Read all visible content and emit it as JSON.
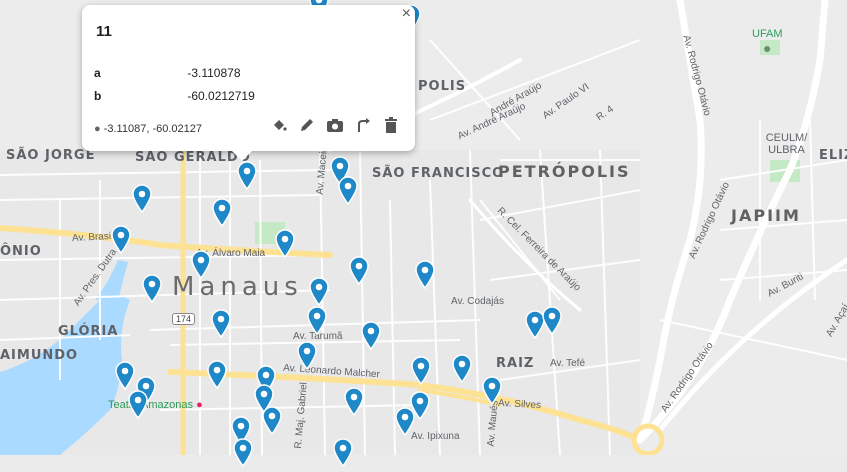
{
  "map": {
    "city_label": "Manaus",
    "neighborhoods": [
      "SÃO JORGE",
      "SÃO GERALDO",
      "SÃO FRANCISCO",
      "PETRÓPOLIS",
      "JAPIIM",
      "RAIZ",
      "GLÓRIA",
      "AIMUNDO",
      "ÔNIO",
      "ELIZ",
      "POLIS"
    ],
    "streets": [
      "Av. Brasil",
      "Av. Álvaro Maia",
      "Av. Pres. Dutra",
      "Av. Tarumã",
      "Av. Leonardo Malcher",
      "Av. Silves",
      "Av. Codajás",
      "Av. Tefé",
      "Av. Ipixuna",
      "Av. Maceió",
      "Av. Rodrigo Otávio",
      "Av. Rodrigo Otávio",
      "Av. Rodrigo Otávio",
      "Av. Buriti",
      "Av. Açaí",
      "Av. André Araújo",
      "Av. Paulo VI",
      "R. 4",
      "R. Cel. Ferreira de Araújo",
      "R. Maj. Gabriel",
      "Av. Maués",
      "André Araújo"
    ],
    "pois": {
      "ufam": "UFAM",
      "ceulm": "CEULM/ ULBRA",
      "teatro": "Teatro Amazonas"
    },
    "route_shield": "174"
  },
  "popup": {
    "title": "11",
    "fields": [
      {
        "key": "a",
        "value": "-3.110878"
      },
      {
        "key": "b",
        "value": "-60.0212719"
      }
    ],
    "coordinates": "-3.11087, -60.02127",
    "close": "×"
  },
  "colors": {
    "marker": "#1e88c8",
    "road": "#ffffff",
    "major_road": "#fde293",
    "water": "#aadaff",
    "park": "#c5e8c5"
  },
  "icons": [
    "pin-icon",
    "paint-bucket-icon",
    "pencil-icon",
    "camera-icon",
    "route-icon",
    "trash-icon",
    "close-icon"
  ]
}
